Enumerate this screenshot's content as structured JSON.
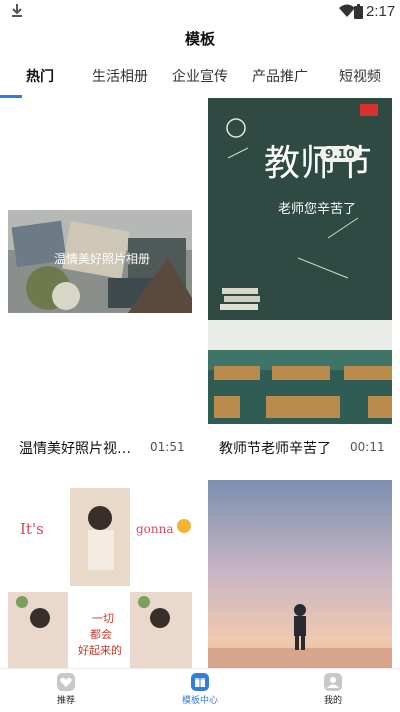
{
  "status_bar": {
    "time": "2:17"
  },
  "header": {
    "title": "模板"
  },
  "tabs": [
    {
      "label": "热门",
      "active": true
    },
    {
      "label": "生活相册",
      "active": false
    },
    {
      "label": "企业宣传",
      "active": false
    },
    {
      "label": "产品推广",
      "active": false
    },
    {
      "label": "短视频",
      "active": false
    }
  ],
  "templates": [
    {
      "title": "温情美好照片视…",
      "duration": "01:51",
      "thumb_caption": "温情美好照片相册"
    },
    {
      "title": "教师节老师辛苦了",
      "duration": "00:11",
      "thumb_title": "教师节",
      "thumb_date": "9.10",
      "thumb_subtitle": "老师您辛苦了"
    },
    {
      "title": "",
      "duration": "",
      "thumb_texts": [
        "It's",
        "gonna",
        "一切",
        "都会",
        "好起来的"
      ]
    },
    {
      "title": "",
      "duration": ""
    }
  ],
  "bottom_nav": [
    {
      "label": "推荐",
      "icon": "heart-icon",
      "active": false
    },
    {
      "label": "模板中心",
      "icon": "template-icon",
      "active": true
    },
    {
      "label": "我的",
      "icon": "user-icon",
      "active": false
    }
  ],
  "colors": {
    "accent": "#2f7fd8",
    "chalkboard": "#2e4a43"
  }
}
